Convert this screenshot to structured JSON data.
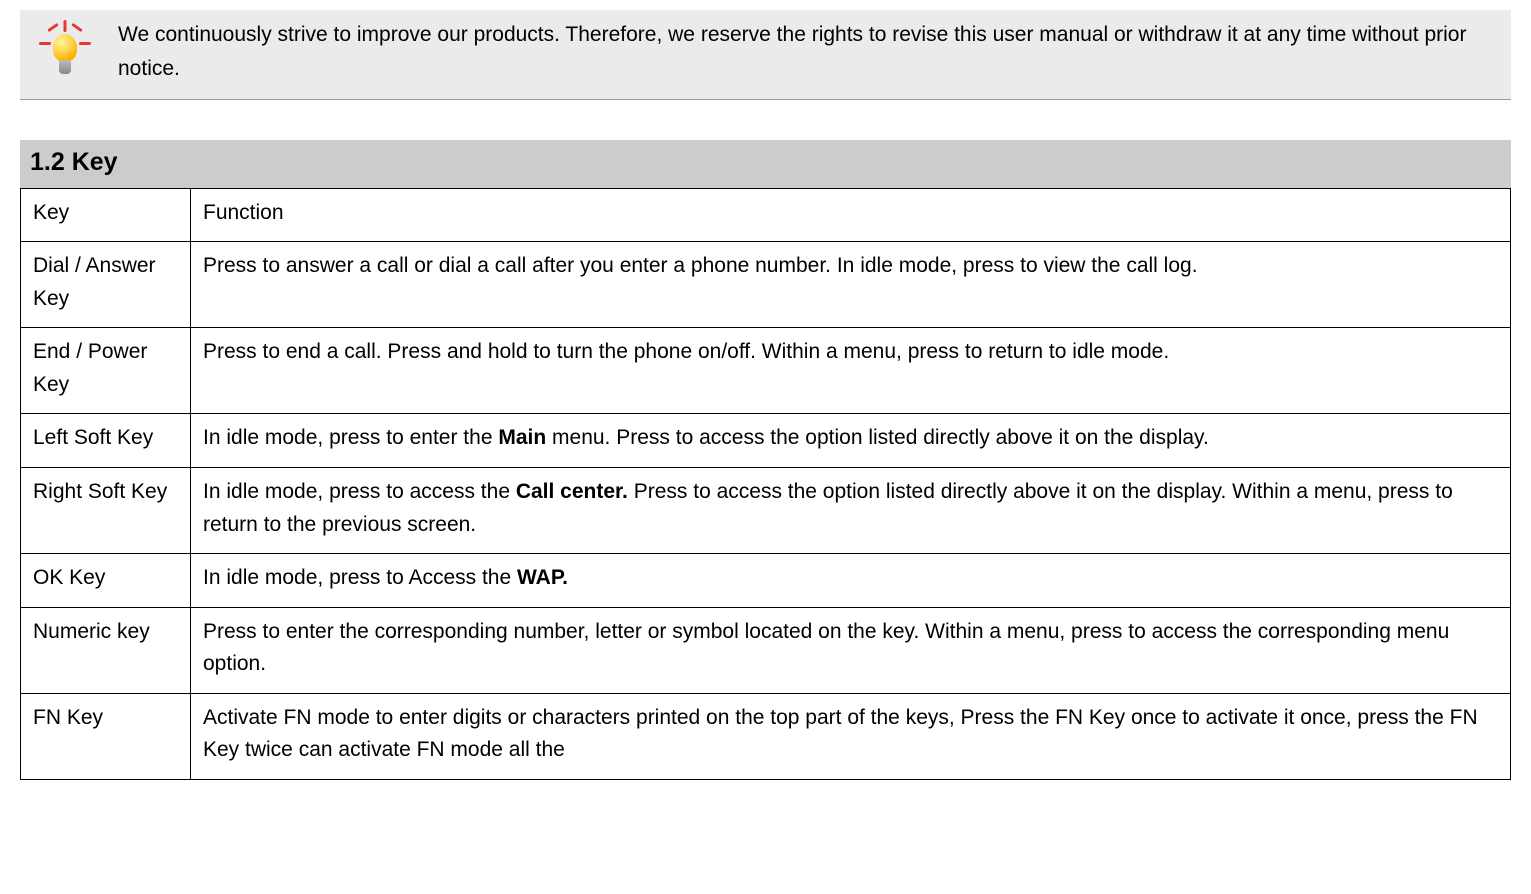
{
  "notice": {
    "text": "We continuously strive to improve our products. Therefore, we reserve the rights to revise this user manual or withdraw it at any time without prior notice."
  },
  "section": {
    "heading": "1.2 Key"
  },
  "table": {
    "header": {
      "col1": "Key",
      "col2": "Function"
    },
    "rows": [
      {
        "key": "Dial / Answer Key",
        "func_plain": "Press to answer a call or dial a call after you enter a phone number. In idle mode, press to view the call log."
      },
      {
        "key": "End / Power Key",
        "func_plain": "Press to end a call. Press and hold to turn the phone on/off. Within a menu, press to return to idle mode."
      },
      {
        "key": "Left Soft Key",
        "func_pre": "In idle mode, press to enter the ",
        "func_bold": "Main",
        "func_post": " menu. Press to access the option listed directly above it on the display."
      },
      {
        "key": "Right Soft Key",
        "func_pre": "In idle mode, press to access the ",
        "func_bold": "Call center.",
        "func_post": " Press to access the option listed directly above it on the display. Within a menu, press to return to the previous screen."
      },
      {
        "key": "OK Key",
        "func_pre": "In idle mode, press to Access the ",
        "func_bold": "WAP.",
        "func_post": ""
      },
      {
        "key": "Numeric key",
        "func_plain": "Press to enter the corresponding number, letter or symbol located on the key. Within a menu, press to access the corresponding menu option."
      },
      {
        "key": "FN Key",
        "func_plain": "Activate FN mode to enter digits or characters printed on the top part of the keys, Press the FN Key once to activate it once, press the FN Key twice can activate FN mode all the"
      }
    ]
  }
}
